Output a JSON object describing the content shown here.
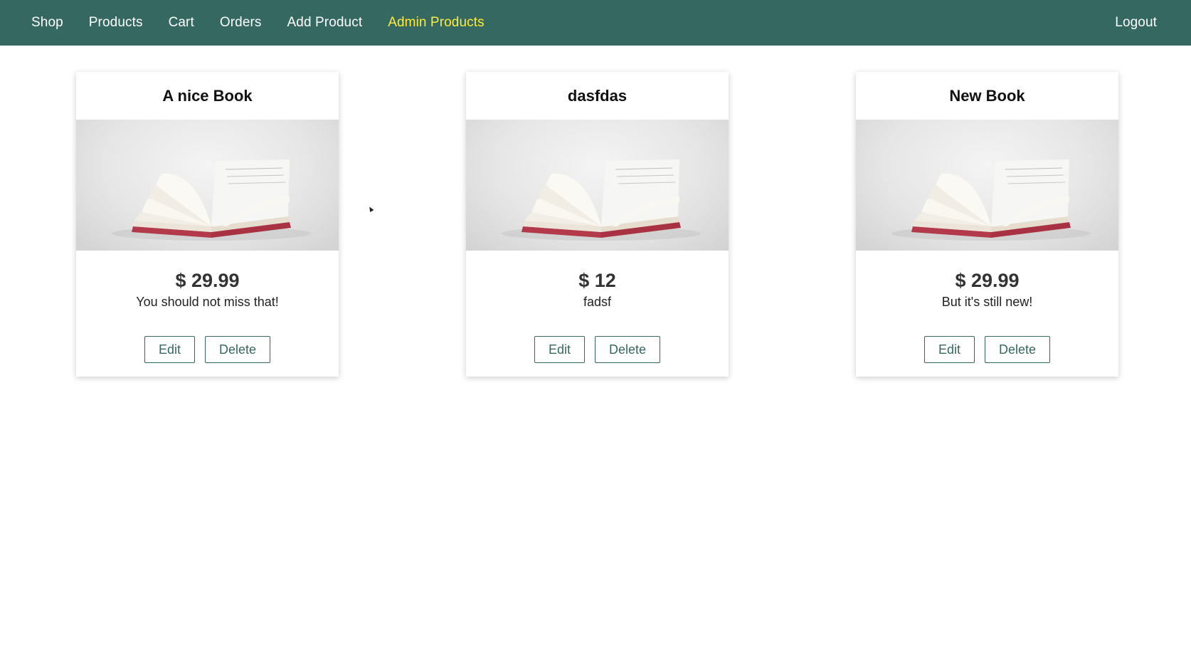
{
  "nav": {
    "items": [
      {
        "label": "Shop",
        "active": false
      },
      {
        "label": "Products",
        "active": false
      },
      {
        "label": "Cart",
        "active": false
      },
      {
        "label": "Orders",
        "active": false
      },
      {
        "label": "Add Product",
        "active": false
      },
      {
        "label": "Admin Products",
        "active": true
      }
    ],
    "logout_label": "Logout",
    "active_color": "#ffeb3b",
    "bar_color": "#346860"
  },
  "products": [
    {
      "title": "A nice Book",
      "price": "$ 29.99",
      "description": "You should not miss that!",
      "image_icon": "open-book-image",
      "edit_label": "Edit",
      "delete_label": "Delete"
    },
    {
      "title": "dasfdas",
      "price": "$ 12",
      "description": "fadsf",
      "image_icon": "open-book-image",
      "edit_label": "Edit",
      "delete_label": "Delete"
    },
    {
      "title": "New Book",
      "price": "$ 29.99",
      "description": "But it's still new!",
      "image_icon": "open-book-image",
      "edit_label": "Edit",
      "delete_label": "Delete"
    }
  ]
}
